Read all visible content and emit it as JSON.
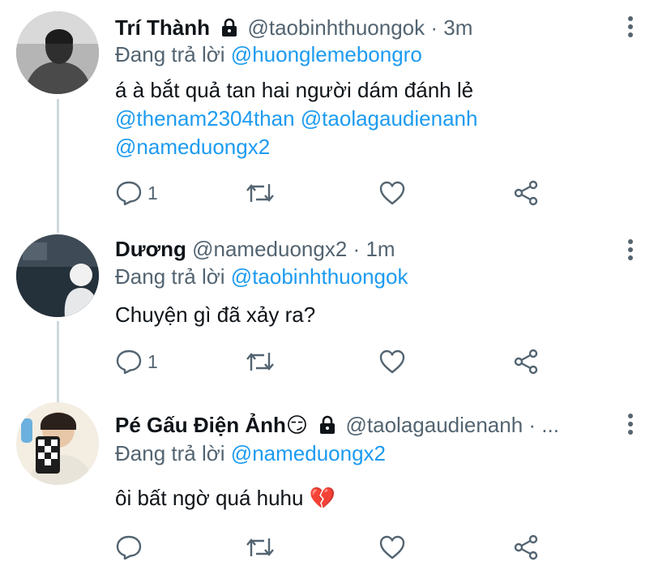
{
  "tweets": [
    {
      "name": "Trí Thành",
      "locked": true,
      "handle": "@taobinhthuongok",
      "separator": "·",
      "time": "3m",
      "reply_prefix": "Đang trả lời",
      "reply_to": "@huonglemebongro",
      "text": "á à bắt quả tan hai người dám đánh lẻ",
      "mentions_line1": "@thenam2304than @taolagaudienanh",
      "mentions_line2": "@nameduongx2",
      "reply_count": "1"
    },
    {
      "name": "Dương",
      "handle": "@nameduongx2",
      "separator": "·",
      "time": "1m",
      "reply_prefix": "Đang trả lời",
      "reply_to": "@taobinhthuongok",
      "text": "Chuyện gì đã xảy ra?",
      "reply_count": "1"
    },
    {
      "name": "Pé Gấu Điện Ảnh",
      "emoji": "😏",
      "locked": true,
      "handle": "@taolagaudienanh · ...",
      "reply_prefix": "Đang trả lời",
      "reply_to": "@nameduongx2",
      "text": "ôi bất ngờ quá huhu",
      "text_emoji": "💔"
    }
  ],
  "icons": {
    "reply": "reply-icon",
    "retweet": "retweet-icon",
    "like": "heart-icon",
    "share": "share-icon",
    "more": "more-vertical-icon",
    "lock": "lock-icon"
  },
  "colors": {
    "link": "#1d9bf0",
    "secondary": "#536471",
    "thread_line": "#cfd9de"
  }
}
